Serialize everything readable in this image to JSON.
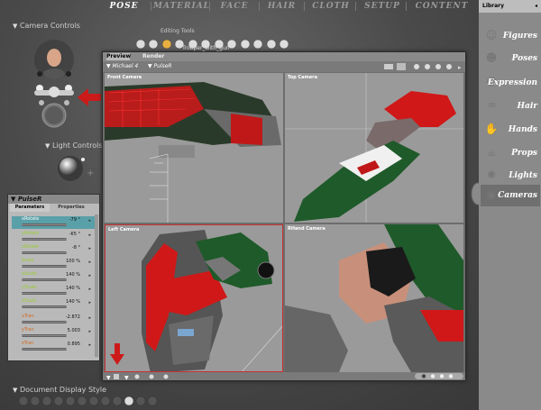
{
  "tabs": [
    "POSE",
    "MATERIAL",
    "FACE",
    "HAIR",
    "CLOTH",
    "SETUP",
    "CONTENT"
  ],
  "active_tab": "POSE",
  "camera_controls": {
    "label": "Camera Controls"
  },
  "light_controls": {
    "label": "Light Controls"
  },
  "editing_tools": {
    "label": "Editing Tools"
  },
  "document": {
    "file_title": "Trooper_with_gun",
    "tabs": [
      "Preview",
      "Render"
    ],
    "figure_menu": "Michael 4",
    "actor_menu": "PulseR",
    "viewports": [
      "Front Camera",
      "Top Camera",
      "Left Camera",
      "RHand Camera"
    ]
  },
  "params_panel": {
    "title": "PulseR",
    "tabs": [
      "Parameters",
      "Properties"
    ],
    "rows": [
      {
        "label": "xRotate",
        "value": "-79 °"
      },
      {
        "label": "yRotate",
        "value": "-65 °"
      },
      {
        "label": "zRotate",
        "value": "-8 °"
      },
      {
        "label": "Scale",
        "value": "100 %"
      },
      {
        "label": "xScale",
        "value": "140 %"
      },
      {
        "label": "yScale",
        "value": "140 %"
      },
      {
        "label": "zScale",
        "value": "140 %"
      },
      {
        "label": "xTran",
        "value": "-2.872"
      },
      {
        "label": "yTran",
        "value": "5.003"
      },
      {
        "label": "zTran",
        "value": "0.895"
      }
    ]
  },
  "library": {
    "title": "Library",
    "items": [
      {
        "label": "Figures",
        "icon": "figure-icon"
      },
      {
        "label": "Poses",
        "icon": "pose-icon"
      },
      {
        "label": "Expression",
        "icon": "face-icon"
      },
      {
        "label": "Hair",
        "icon": "hair-icon"
      },
      {
        "label": "Hands",
        "icon": "hand-icon"
      },
      {
        "label": "Props",
        "icon": "cup-icon"
      },
      {
        "label": "Lights",
        "icon": "bulb-icon"
      },
      {
        "label": "Cameras",
        "icon": "camera-icon"
      }
    ]
  },
  "document_display_style": {
    "label": "Document Display Style"
  },
  "colors": {
    "accent_red": "#d01818",
    "gun_green": "#1f5a2a",
    "selected_row": "#5aa0a8"
  }
}
